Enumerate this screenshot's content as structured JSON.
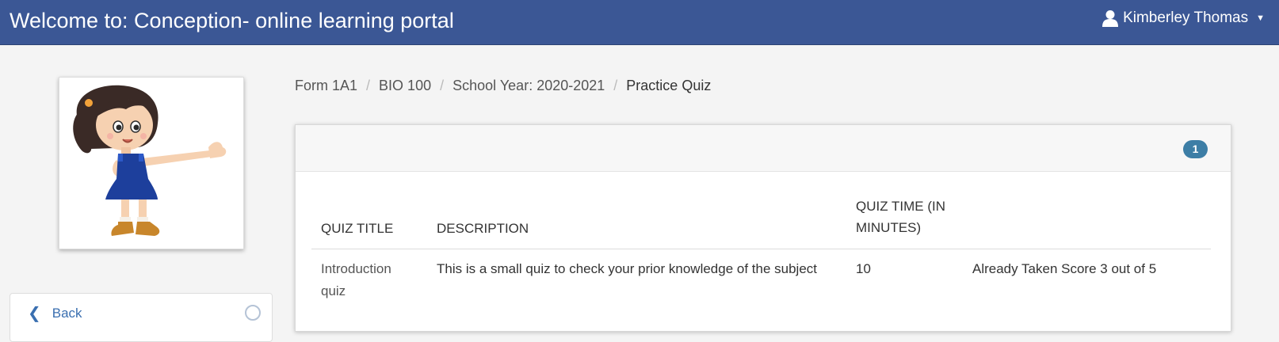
{
  "app": {
    "title": "Welcome to: Conception- online learning portal",
    "user_name": "Kimberley Thomas"
  },
  "icons": {
    "user": "user-icon",
    "caret": "caret-down-icon",
    "back": "chevron-left-icon",
    "avatar": "girl-avatar-illustration"
  },
  "colors": {
    "topbar": "#3b5795",
    "badge": "#3d7ea6",
    "link": "#3a6fb0"
  },
  "sidebar": {
    "back_label": "Back"
  },
  "breadcrumb": {
    "items": [
      "Form 1A1",
      "BIO 100",
      "School Year: 2020-2021",
      "Practice Quiz"
    ]
  },
  "panel": {
    "count_badge": "1"
  },
  "table": {
    "headers": [
      "QUIZ TITLE",
      "DESCRIPTION",
      "QUIZ TIME (IN MINUTES)"
    ],
    "rows": [
      {
        "title": "Introduction quiz",
        "description": "This is a small quiz to check your prior knowledge of the subject",
        "time": "10",
        "status": "Already Taken Score 3 out of 5"
      }
    ]
  }
}
